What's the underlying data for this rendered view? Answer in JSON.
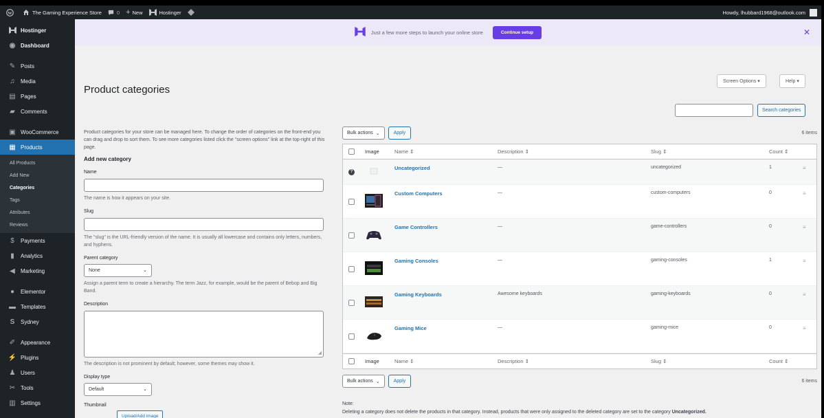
{
  "adminbar": {
    "site_name": "The Gaming Experience Store",
    "comments_count": "0",
    "new_label": "New",
    "hostinger_label": "Hostinger",
    "howdy": "Howdy, lhubbard1968@outlook.com"
  },
  "sidebar": {
    "items_top": [
      {
        "label": "Hostinger",
        "icon": "hostinger-icon"
      },
      {
        "label": "Dashboard",
        "icon": "dashboard-icon"
      }
    ],
    "items_mid": [
      {
        "label": "Posts",
        "icon": "pin-icon"
      },
      {
        "label": "Media",
        "icon": "media-icon"
      },
      {
        "label": "Pages",
        "icon": "pages-icon"
      },
      {
        "label": "Comments",
        "icon": "comment-icon"
      }
    ],
    "woocommerce": "WooCommerce",
    "products": "Products",
    "submenu": [
      "All Products",
      "Add New",
      "Categories",
      "Tags",
      "Attributes",
      "Reviews"
    ],
    "items_after": [
      {
        "label": "Payments",
        "icon": "payments-icon"
      },
      {
        "label": "Analytics",
        "icon": "analytics-icon"
      },
      {
        "label": "Marketing",
        "icon": "marketing-icon"
      }
    ],
    "items_elementor": [
      {
        "label": "Elementor",
        "icon": "elementor-icon"
      },
      {
        "label": "Templates",
        "icon": "templates-icon"
      },
      {
        "label": "Sydney",
        "icon": "sydney-icon"
      }
    ],
    "items_bottom": [
      {
        "label": "Appearance",
        "icon": "appearance-icon"
      },
      {
        "label": "Plugins",
        "icon": "plugins-icon"
      },
      {
        "label": "Users",
        "icon": "users-icon"
      },
      {
        "label": "Tools",
        "icon": "tools-icon"
      },
      {
        "label": "Settings",
        "icon": "settings-icon"
      }
    ]
  },
  "banner": {
    "text": "Just a few more steps to launch your online store",
    "button": "Continue setup",
    "close": "✕"
  },
  "page": {
    "title": "Product categories",
    "screen_options": "Screen Options ▾",
    "help": "Help ▾",
    "search_button": "Search categories"
  },
  "form": {
    "intro": "Product categories for your store can be managed here. To change the order of categories on the front-end you can drag and drop to sort them. To see more categories listed click the \"screen options\" link at the top-right of this page.",
    "heading": "Add new category",
    "name_label": "Name",
    "name_help": "The name is how it appears on your site.",
    "slug_label": "Slug",
    "slug_help": "The \"slug\" is the URL-friendly version of the name. It is usually all lowercase and contains only letters, numbers, and hyphens.",
    "parent_label": "Parent category",
    "parent_value": "None",
    "parent_help": "Assign a parent term to create a hierarchy. The term Jazz, for example, would be the parent of Bebop and Big Band.",
    "description_label": "Description",
    "description_help": "The description is not prominent by default; however, some themes may show it.",
    "display_type_label": "Display type",
    "display_type_value": "Default",
    "thumbnail_label": "Thumbnail",
    "upload_button": "Upload/Add image"
  },
  "table": {
    "bulk_actions": "Bulk actions",
    "apply": "Apply",
    "items_count": "6 items",
    "columns": {
      "image": "Image",
      "name": "Name",
      "description": "Description",
      "slug": "Slug",
      "count": "Count"
    },
    "rows": [
      {
        "name": "Uncategorized",
        "description": "—",
        "slug": "uncategorized",
        "count": "1",
        "thumb": "placeholder"
      },
      {
        "name": "Custom Computers",
        "description": "—",
        "slug": "custom-computers",
        "count": "0",
        "thumb": "computer"
      },
      {
        "name": "Game Controllers",
        "description": "—",
        "slug": "game-controllers",
        "count": "0",
        "thumb": "controller"
      },
      {
        "name": "Gaming Consoles",
        "description": "—",
        "slug": "gaming-consoles",
        "count": "1",
        "thumb": "console"
      },
      {
        "name": "Gaming Keyboards",
        "description": "Awesome keyboards",
        "slug": "gaming-keyboards",
        "count": "0",
        "thumb": "keyboard"
      },
      {
        "name": "Gaming Mice",
        "description": "—",
        "slug": "gaming-mice",
        "count": "0",
        "thumb": "mouse"
      }
    ]
  },
  "note": {
    "label": "Note:",
    "text": "Deleting a category does not delete the products in that category. Instead, products that were only assigned to the deleted category are set to the category",
    "bold": "Uncategorized."
  },
  "colors": {
    "sidebar": "#1d2327",
    "active": "#2271b1",
    "banner": "#ece8f8",
    "hostinger_purple": "#673de6"
  }
}
